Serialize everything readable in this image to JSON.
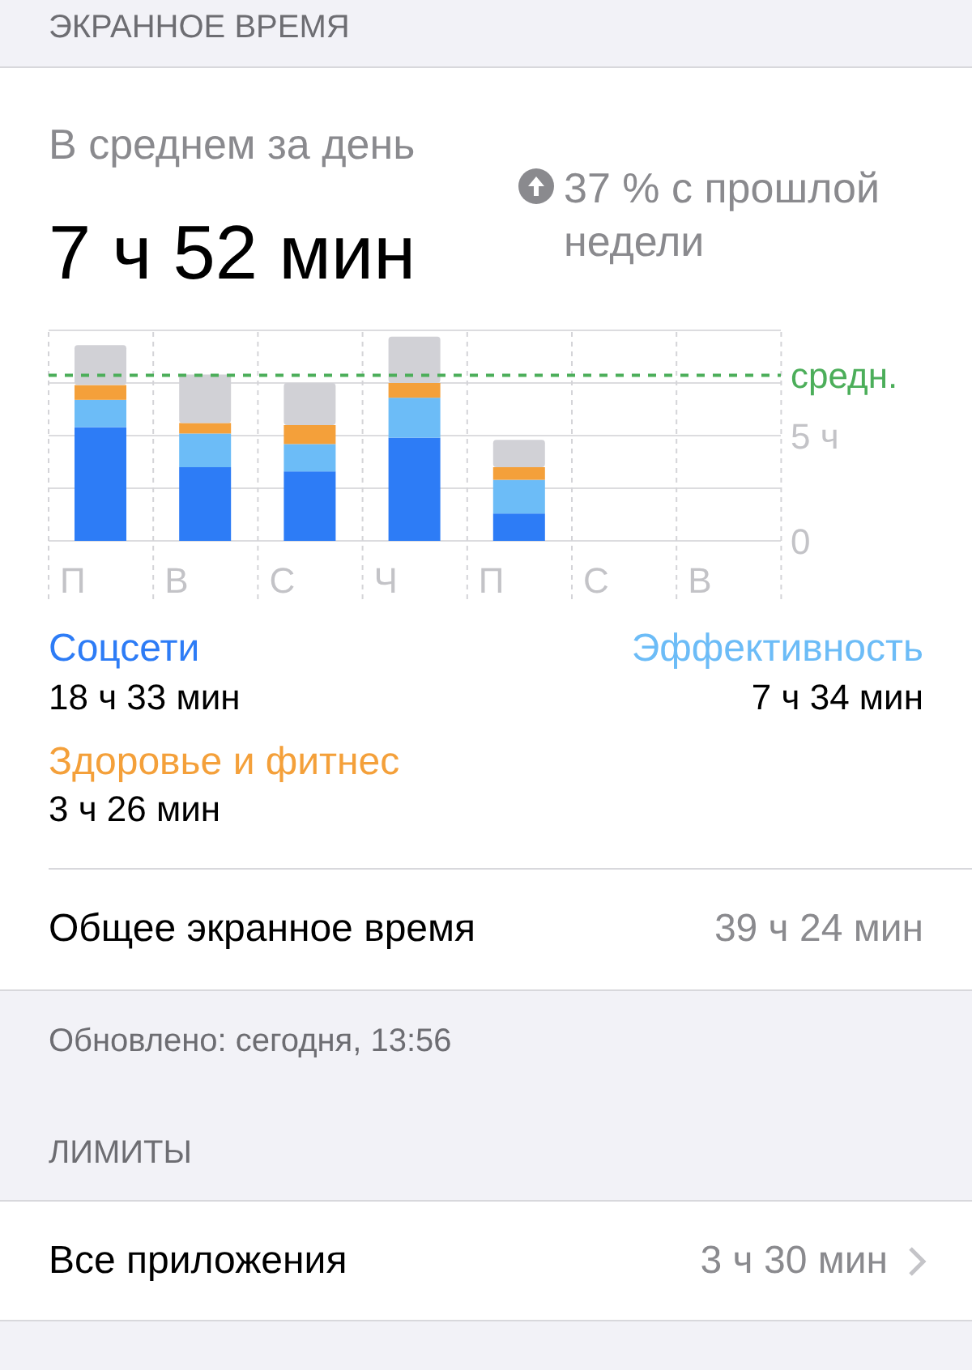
{
  "section_header": "ЭКРАННОЕ ВРЕМЯ",
  "summary": {
    "label": "В среднем за день",
    "value": "7 ч 52 мин",
    "change": "37 % с прошлой недели"
  },
  "chart_data": {
    "type": "bar",
    "stacked": true,
    "categories": [
      "П",
      "В",
      "С",
      "Ч",
      "П",
      "С",
      "В"
    ],
    "series": [
      {
        "name": "Соцсети",
        "color": "#2d7cf6",
        "values": [
          5.4,
          3.5,
          3.3,
          4.9,
          1.3,
          null,
          null
        ]
      },
      {
        "name": "Эффективность",
        "color": "#6cbcf7",
        "values": [
          1.3,
          1.6,
          1.3,
          1.9,
          1.6,
          null,
          null
        ]
      },
      {
        "name": "Здоровье и фитнес",
        "color": "#f4a03a",
        "values": [
          0.7,
          0.5,
          0.9,
          0.7,
          0.6,
          null,
          null
        ]
      },
      {
        "color": "#d1d1d6",
        "values": [
          1.9,
          2.3,
          2.0,
          2.2,
          1.3,
          null,
          null
        ]
      }
    ],
    "ylim": [
      0,
      10
    ],
    "yticks": [
      {
        "value": 0,
        "label": "0"
      },
      {
        "value": 5,
        "label": "5 ч"
      }
    ],
    "ref_lines": [
      {
        "axis": "y",
        "value": 7.87,
        "label": "средн.",
        "color": "#4cae5a"
      }
    ]
  },
  "legend": [
    {
      "value": "18 ч 33 мин"
    },
    {
      "value": "7 ч 34 мин"
    },
    {
      "value": "3 ч 26 мин"
    }
  ],
  "total": {
    "label": "Общее экранное время",
    "value": "39 ч 24 мин"
  },
  "updated": "Обновлено: сегодня, 13:56",
  "limits_header": "ЛИМИТЫ",
  "limits": [
    {
      "label": "Все приложения",
      "value": "3 ч 30 мин"
    }
  ]
}
